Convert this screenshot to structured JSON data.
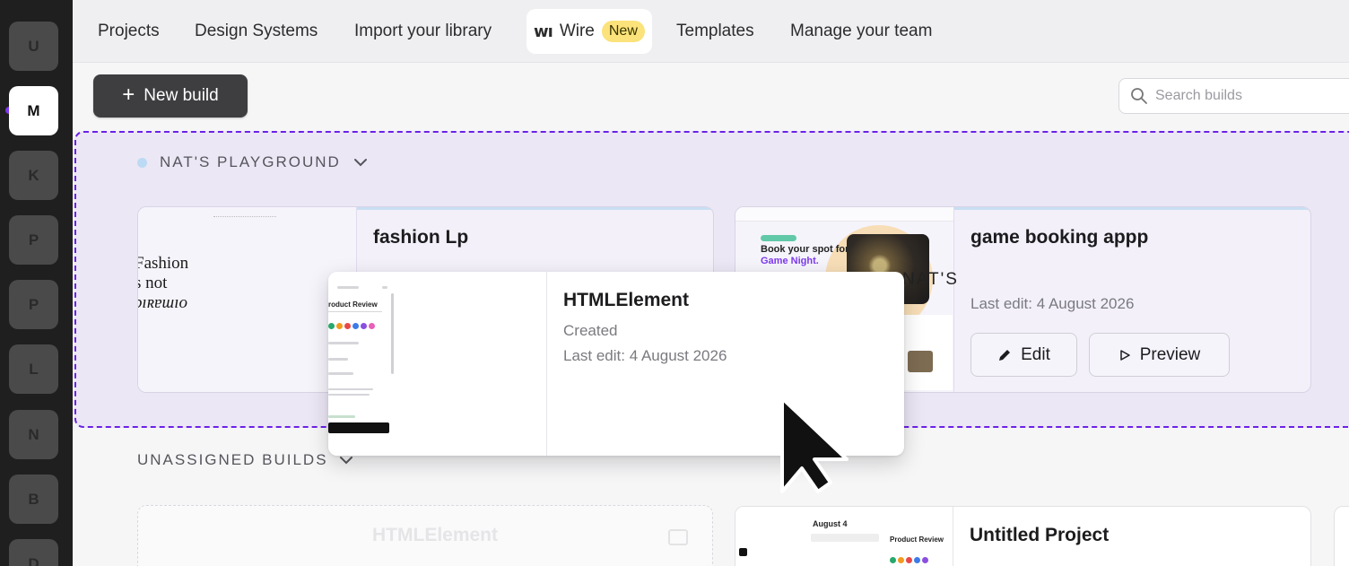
{
  "workspaces": [
    {
      "letter": "U"
    },
    {
      "letter": "M",
      "active": true
    },
    {
      "letter": "K"
    },
    {
      "letter": "P"
    },
    {
      "letter": "P"
    },
    {
      "letter": "L"
    },
    {
      "letter": "N"
    },
    {
      "letter": "B"
    },
    {
      "letter": "D"
    }
  ],
  "nav": {
    "projects": "Projects",
    "design_systems": "Design Systems",
    "import_library": "Import your library",
    "wire_logo": "wı",
    "wire": "Wire",
    "wire_badge": "New",
    "templates": "Templates",
    "manage_team": "Manage your team"
  },
  "toolbar": {
    "new_build_label": "New build",
    "search_placeholder": "Search builds"
  },
  "group": {
    "title": "NAT'S PLAYGROUND",
    "cards": [
      {
        "title": "fashion Lp",
        "thumb_text": [
          "Fashion",
          "s not",
          "ɔıʀɐɯıo"
        ]
      },
      {
        "title": "game booking appp",
        "last_edit": "Last edit: 4 August 2026",
        "edit_label": "Edit",
        "preview_label": "Preview",
        "thumb_heading_1": "Book your spot for",
        "thumb_heading_2": "Game Night."
      }
    ],
    "overlay_text": "NAT'S"
  },
  "dragged_card": {
    "title": "HTMLElement",
    "status": "Created",
    "last_edit": "Last edit: 4 August 2026",
    "thumb_heading": "roduct Review",
    "swatches": [
      "#26a96b",
      "#f29b1e",
      "#e94848",
      "#3c7be8",
      "#8a4fe0",
      "#e85fb8"
    ]
  },
  "unassigned": {
    "title": "UNASSIGNED BUILDS",
    "cards": [
      {
        "title": "HTMLElement",
        "ghost": true
      },
      {
        "title": "Untitled Project",
        "thumb_heading": "August 4",
        "thumb_sub": "Product Review"
      }
    ]
  },
  "colors": {
    "accent": "#6b21e8",
    "group_bg": "#ece7f5",
    "badge": "#fbe27a"
  }
}
